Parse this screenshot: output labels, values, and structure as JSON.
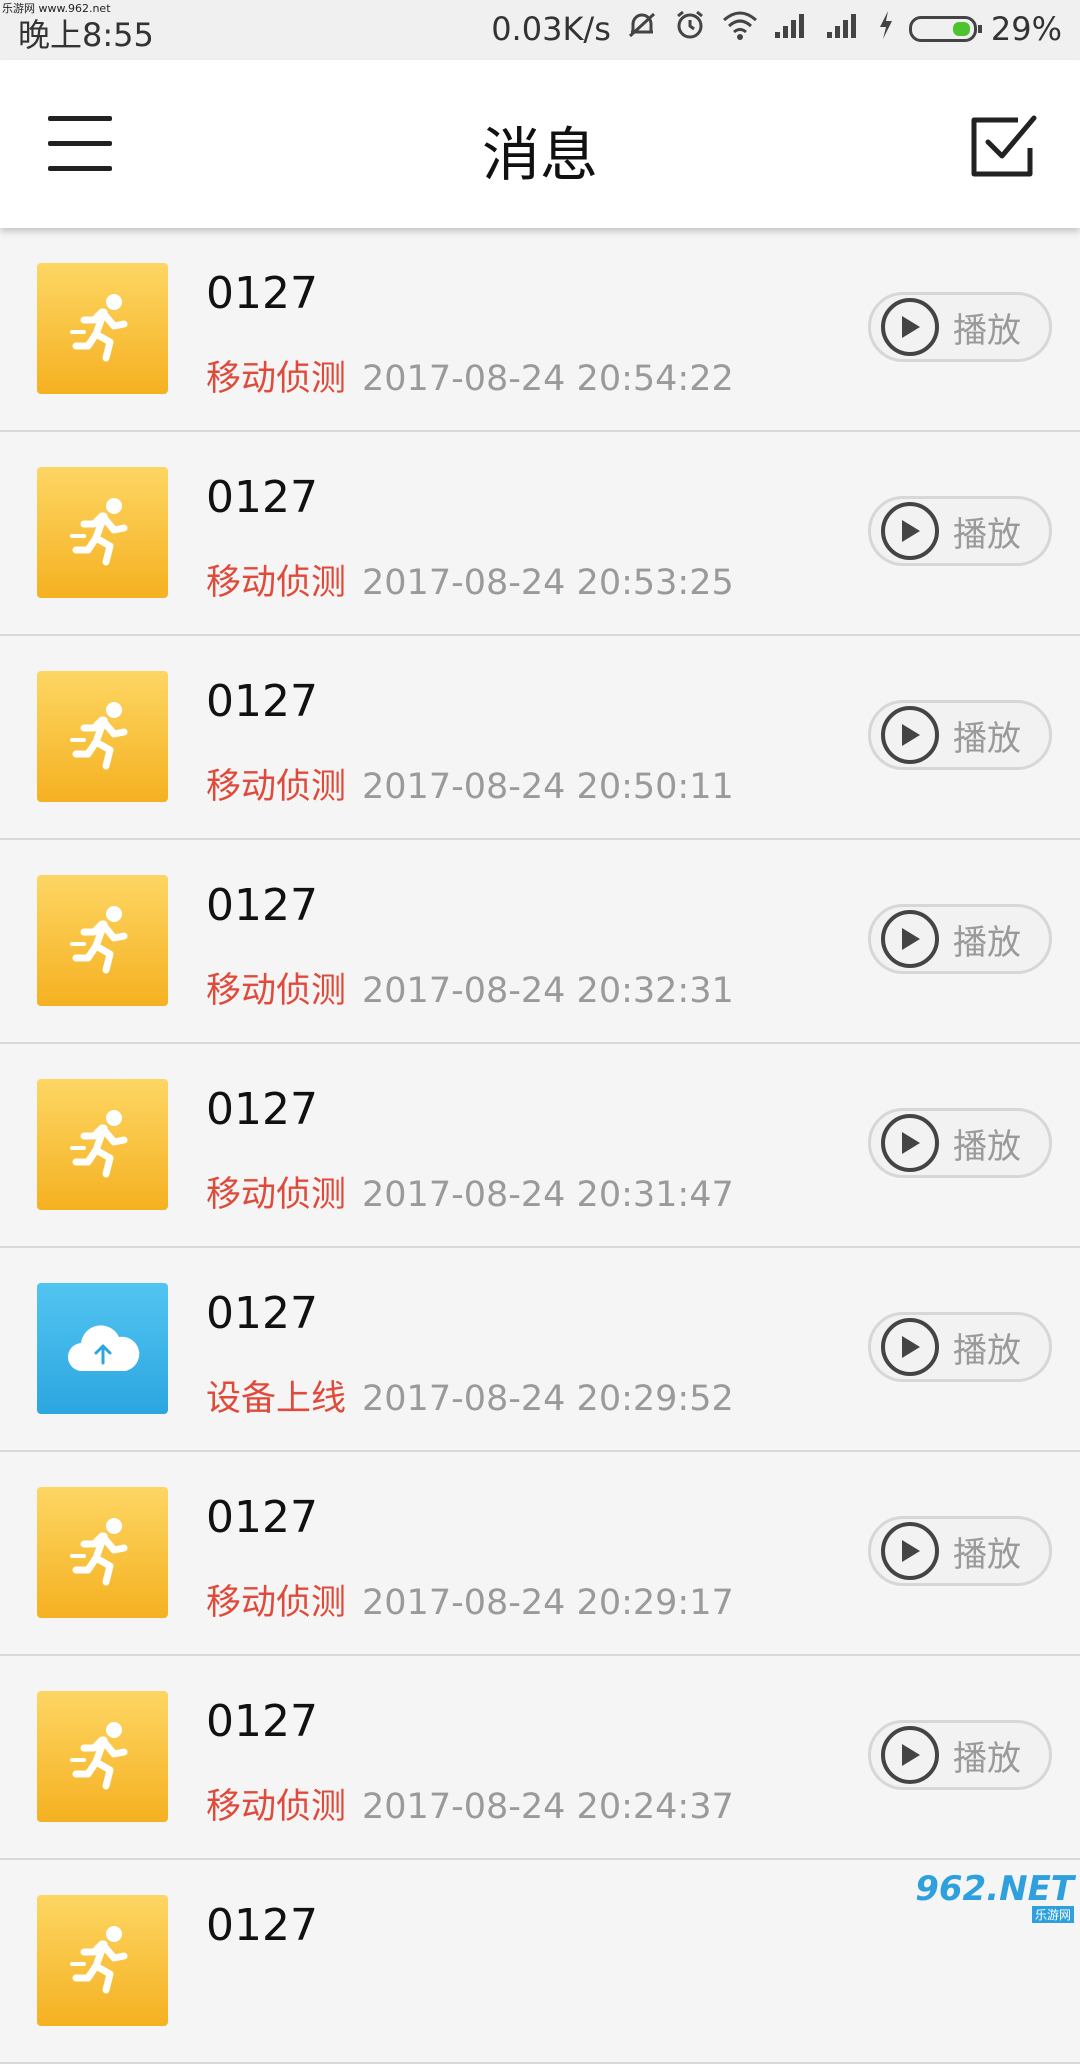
{
  "watermark": {
    "top_text": "乐游网 www.962.net",
    "logo": "962.NET",
    "sub": "乐游网"
  },
  "statusbar": {
    "time": "晚上8:55",
    "speed": "0.03K/s",
    "battery_percent": "29%",
    "battery_level": 0.29,
    "icons": [
      "mute-icon",
      "alarm-icon",
      "wifi-icon",
      "signal-icon",
      "signal-icon",
      "charging-icon",
      "battery-icon"
    ]
  },
  "header": {
    "title": "消息",
    "left_icon": "menu-icon",
    "right_icon": "checkbox-icon"
  },
  "colors": {
    "motion": "#f5b121",
    "online": "#2ca6e0",
    "event_red": "#e04a3a",
    "time_gray": "#9a9a9a"
  },
  "messages": [
    {
      "name": "0127",
      "type": "移动侦测",
      "time": "2017-08-24 20:54:22",
      "icon": "running-person-icon",
      "action": "播放"
    },
    {
      "name": "0127",
      "type": "移动侦测",
      "time": "2017-08-24 20:53:25",
      "icon": "running-person-icon",
      "action": "播放"
    },
    {
      "name": "0127",
      "type": "移动侦测",
      "time": "2017-08-24 20:50:11",
      "icon": "running-person-icon",
      "action": "播放"
    },
    {
      "name": "0127",
      "type": "移动侦测",
      "time": "2017-08-24 20:32:31",
      "icon": "running-person-icon",
      "action": "播放"
    },
    {
      "name": "0127",
      "type": "移动侦测",
      "time": "2017-08-24 20:31:47",
      "icon": "running-person-icon",
      "action": "播放"
    },
    {
      "name": "0127",
      "type": "设备上线",
      "time": "2017-08-24 20:29:52",
      "icon": "cloud-upload-icon",
      "action": "播放"
    },
    {
      "name": "0127",
      "type": "移动侦测",
      "time": "2017-08-24 20:29:17",
      "icon": "running-person-icon",
      "action": "播放"
    },
    {
      "name": "0127",
      "type": "移动侦测",
      "time": "2017-08-24 20:24:37",
      "icon": "running-person-icon",
      "action": "播放"
    },
    {
      "name": "0127",
      "type": "",
      "time": "",
      "icon": "running-person-icon",
      "action": ""
    }
  ]
}
